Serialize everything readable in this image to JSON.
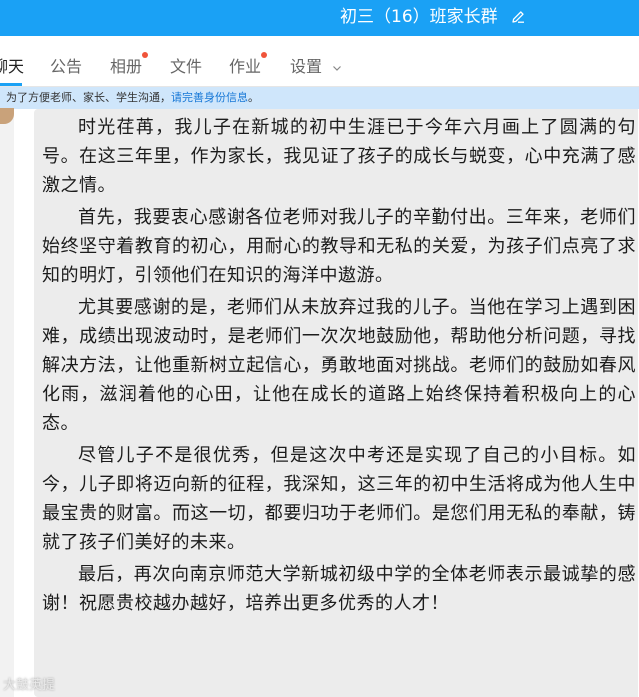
{
  "header": {
    "title": "初三（16）班家长群"
  },
  "tabs": [
    {
      "label": "聊天",
      "visible": "聊天"
    },
    {
      "label": "公告"
    },
    {
      "label": "相册",
      "badge": true
    },
    {
      "label": "文件"
    },
    {
      "label": "作业",
      "badge": true
    },
    {
      "label": "设置"
    }
  ],
  "notice": {
    "text": "为了方便老师、家长、学生沟通，",
    "link": "请完善身份信息",
    "end": "。"
  },
  "message": {
    "paragraphs": [
      "时光荏苒，我儿子在新城的初中生涯已于今年六月画上了圆满的句号。在这三年里，作为家长，我见证了孩子的成长与蜕变，心中充满了感激之情。",
      "首先，我要衷心感谢各位老师对我儿子的辛勤付出。三年来，老师们始终坚守着教育的初心，用耐心的教导和无私的关爱，为孩子们点亮了求知的明灯，引领他们在知识的海洋中遨游。",
      "尤其要感谢的是，老师们从未放弃过我的儿子。当他在学习上遇到困难，成绩出现波动时，是老师们一次次地鼓励他，帮助他分析问题，寻找解决方法，让他重新树立起信心，勇敢地面对挑战。老师们的鼓励如春风化雨，滋润着他的心田，让他在成长的道路上始终保持着积极向上的心态。",
      "尽管儿子不是很优秀，但是这次中考还是实现了自己的小目标。如今，儿子即将迈向新的征程，我深知，这三年的初中生活将成为他人生中最宝贵的财富。而这一切，都要归功于老师们。是您们用无私的奉献，铸就了孩子们美好的未来。",
      "最后，再次向南京师范大学新城初级中学的全体老师表示最诚挚的感谢！祝愿贵校越办越好，培养出更多优秀的人才！"
    ]
  },
  "watermark": "大鼓英提",
  "colors": {
    "accent": "#1aa1f5",
    "badge": "#f0543a",
    "link": "#1677d6",
    "bubble": "#ececec"
  },
  "icons": [
    "edit-icon",
    "chevron-down-icon"
  ]
}
